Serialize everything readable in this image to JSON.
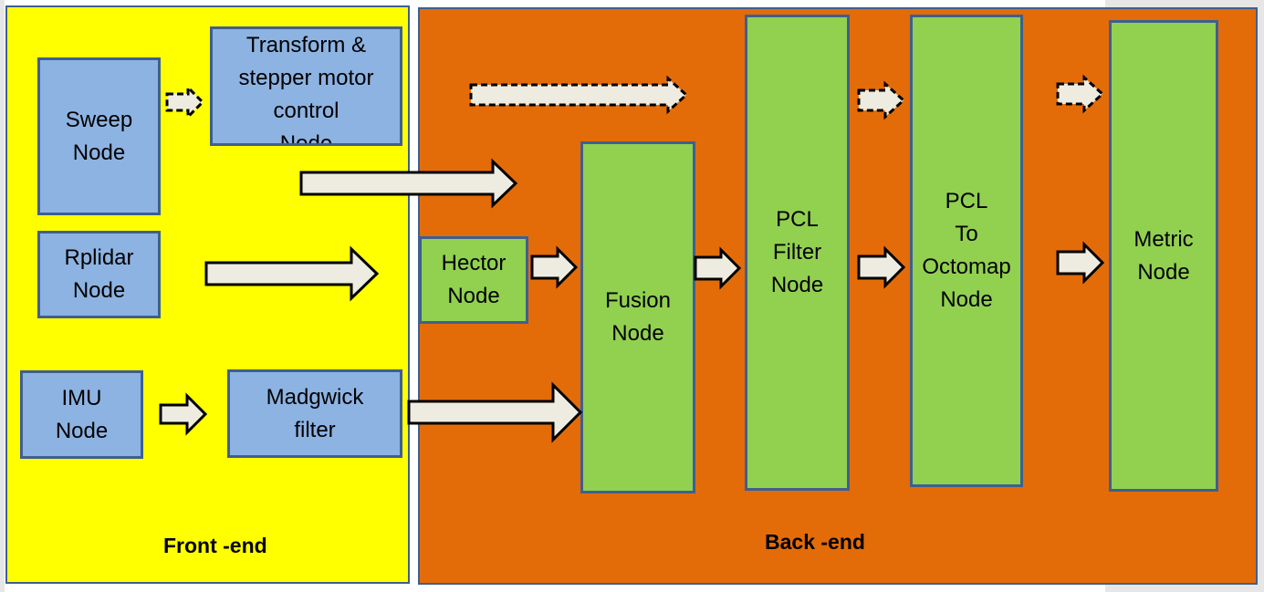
{
  "colors": {
    "front_end_bg": "#ffff00",
    "back_end_bg": "#e36c09",
    "front_node": "#8db3e2",
    "back_node": "#92d050",
    "border": "#3f5f8f",
    "arrow_fill": "#eeece1"
  },
  "front_end": {
    "label": "Front -end",
    "nodes": {
      "sweep": "Sweep\nNode",
      "transform": "Transform &\nstepper motor\ncontrol\nNode",
      "rplidar": "Rplidar\nNode",
      "imu": "IMU\nNode",
      "madgwick": "Madgwick\nfilter"
    }
  },
  "back_end": {
    "label": "Back -end",
    "nodes": {
      "hector": "Hector\nNode",
      "fusion": "Fusion\nNode",
      "pcl_filter": "PCL\nFilter\nNode",
      "pcl_octomap": "PCL\nTo\nOctomap\nNode",
      "metric": "Metric\nNode"
    }
  }
}
